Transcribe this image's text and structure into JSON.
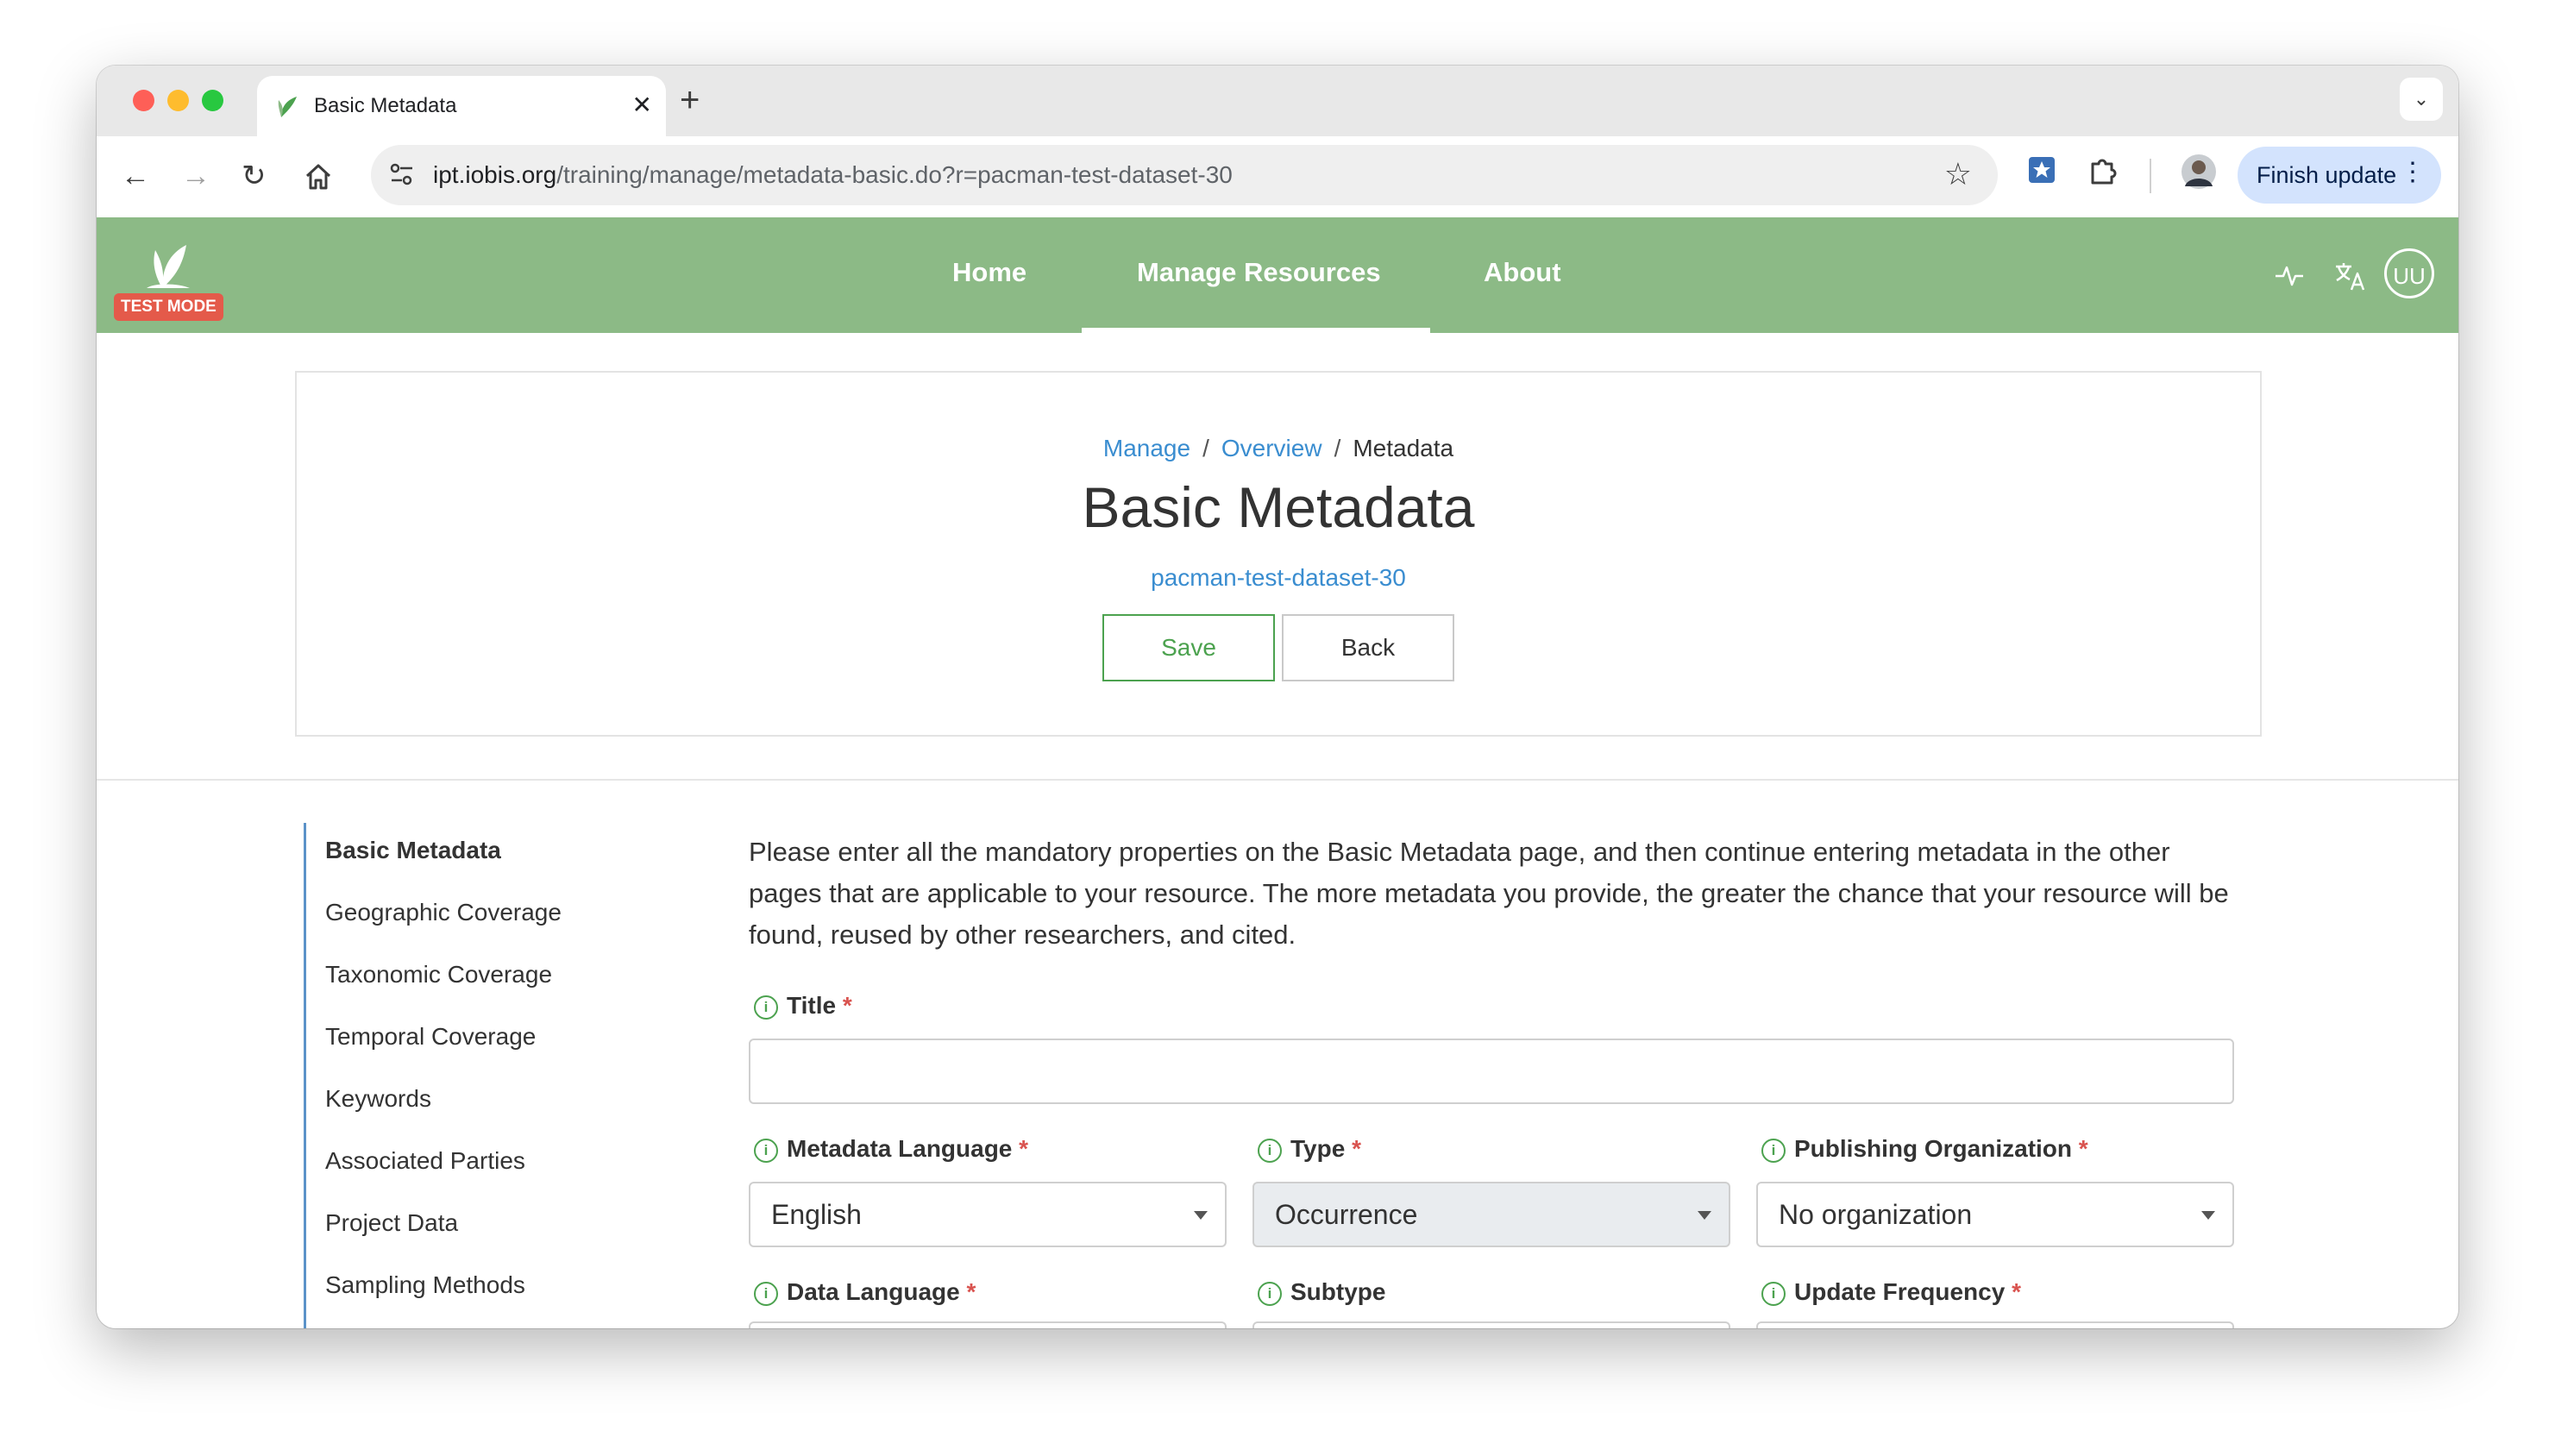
{
  "browser": {
    "tab_title": "Basic Metadata",
    "url_host": "ipt.iobis.org",
    "url_path": "/training/manage/metadata-basic.do?r=pacman-test-dataset-30",
    "finish_update_label": "Finish update"
  },
  "site": {
    "test_mode_badge": "TEST MODE",
    "nav": [
      "Home",
      "Manage Resources",
      "About"
    ],
    "active_nav": "Manage Resources",
    "user_initials": "UU",
    "accent_color": "#8cba86"
  },
  "header": {
    "breadcrumb": [
      "Manage",
      "Overview",
      "Metadata"
    ],
    "breadcrumb_sep": "/",
    "title": "Basic Metadata",
    "resource_name": "pacman-test-dataset-30",
    "save_label": "Save",
    "back_label": "Back"
  },
  "sidebar": {
    "items": [
      "Basic Metadata",
      "Geographic Coverage",
      "Taxonomic Coverage",
      "Temporal Coverage",
      "Keywords",
      "Associated Parties",
      "Project Data",
      "Sampling Methods"
    ],
    "active": "Basic Metadata"
  },
  "form": {
    "intro": "Please enter all the mandatory properties on the Basic Metadata page, and then continue entering metadata in the other pages that are applicable to your resource. The more metadata you provide, the greater the chance that your resource will be found, reused by other researchers, and cited.",
    "info_icon_glyph": "i",
    "required_mark": "*",
    "title_label": "Title",
    "title_value": "",
    "metadata_language_label": "Metadata Language",
    "metadata_language_value": "English",
    "type_label": "Type",
    "type_value": "Occurrence",
    "publishing_org_label": "Publishing Organization",
    "publishing_org_value": "No organization",
    "data_language_label": "Data Language",
    "subtype_label": "Subtype",
    "update_frequency_label": "Update Frequency"
  }
}
